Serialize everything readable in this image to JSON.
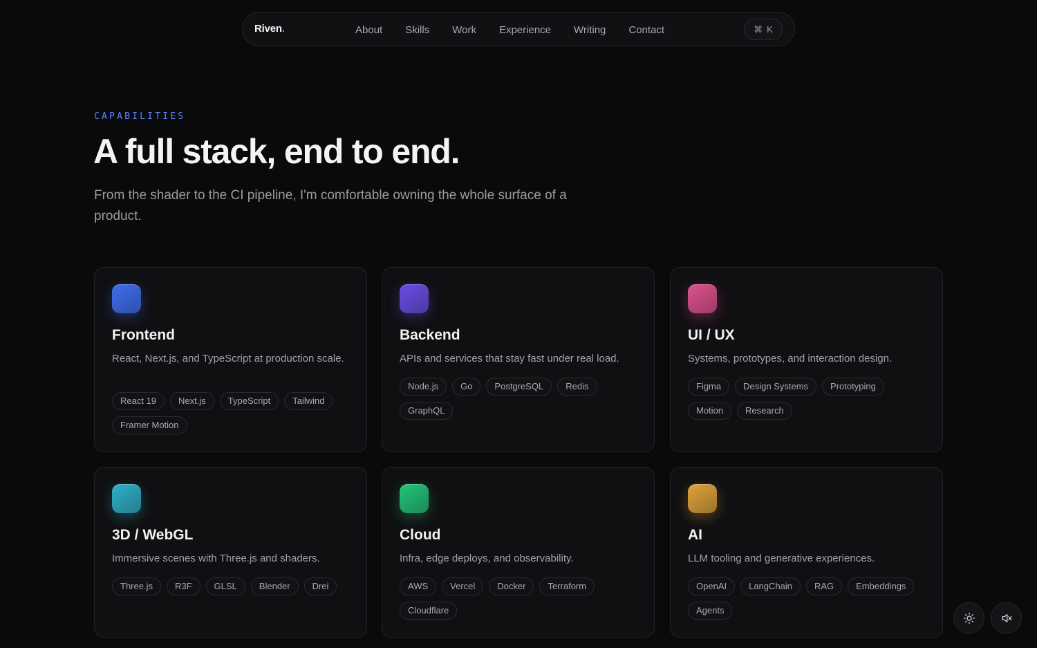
{
  "nav": {
    "brand": "Riven",
    "brand_dot": ".",
    "links": [
      "About",
      "Skills",
      "Work",
      "Experience",
      "Writing",
      "Contact"
    ],
    "shortcut_symbol": "⌘",
    "shortcut_key": "K"
  },
  "hero": {
    "eyebrow": "CAPABILITIES",
    "title": "A full stack, end to end.",
    "subtitle": "From the shader to the CI pipeline, I'm comfortable owning the whole surface of a product."
  },
  "cards": [
    {
      "title": "Frontend",
      "desc": "React, Next.js, and TypeScript at production scale.",
      "tags": [
        "React 19",
        "Next.js",
        "TypeScript",
        "Tailwind",
        "Framer Motion"
      ],
      "color": "#3f6ef0"
    },
    {
      "title": "Backend",
      "desc": "APIs and services that stay fast under real load.",
      "tags": [
        "Node.js",
        "Go",
        "PostgreSQL",
        "Redis",
        "GraphQL"
      ],
      "color": "#6a4de6"
    },
    {
      "title": "UI / UX",
      "desc": "Systems, prototypes, and interaction design.",
      "tags": [
        "Figma",
        "Design Systems",
        "Prototyping",
        "Motion",
        "Research"
      ],
      "color": "#e0518f"
    },
    {
      "title": "3D / WebGL",
      "desc": "Immersive scenes with Three.js and shaders.",
      "tags": [
        "Three.js",
        "R3F",
        "GLSL",
        "Blender",
        "Drei"
      ],
      "color": "#2fb2c9"
    },
    {
      "title": "Cloud",
      "desc": "Infra, edge deploys, and observability.",
      "tags": [
        "AWS",
        "Vercel",
        "Docker",
        "Terraform",
        "Cloudflare"
      ],
      "color": "#23c57a"
    },
    {
      "title": "AI",
      "desc": "LLM tooling and generative experiences.",
      "tags": [
        "OpenAI",
        "LangChain",
        "RAG",
        "Embeddings",
        "Agents"
      ],
      "color": "#e0a43a"
    }
  ],
  "controls": {
    "theme_icon": "sun-icon",
    "sound_icon": "speaker-muted-icon"
  }
}
